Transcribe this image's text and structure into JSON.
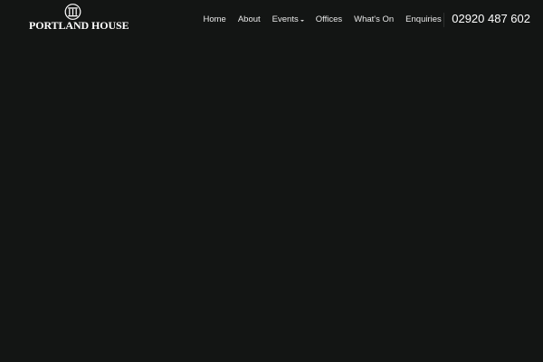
{
  "header": {
    "logo": {
      "text": "PORTLAND HOUSE",
      "icon": "portico-columns-icon"
    },
    "nav": {
      "items": [
        {
          "label": "Home"
        },
        {
          "label": "About"
        },
        {
          "label": "Events",
          "has_dropdown": true
        },
        {
          "label": "Offices"
        },
        {
          "label": "What's On"
        },
        {
          "label": "Enquiries"
        }
      ]
    },
    "phone": "02920 487 602"
  },
  "colors": {
    "background": "#131514",
    "text": "#ffffff",
    "nav_text": "#e9e9e9",
    "divider": "#2c2e2d"
  }
}
